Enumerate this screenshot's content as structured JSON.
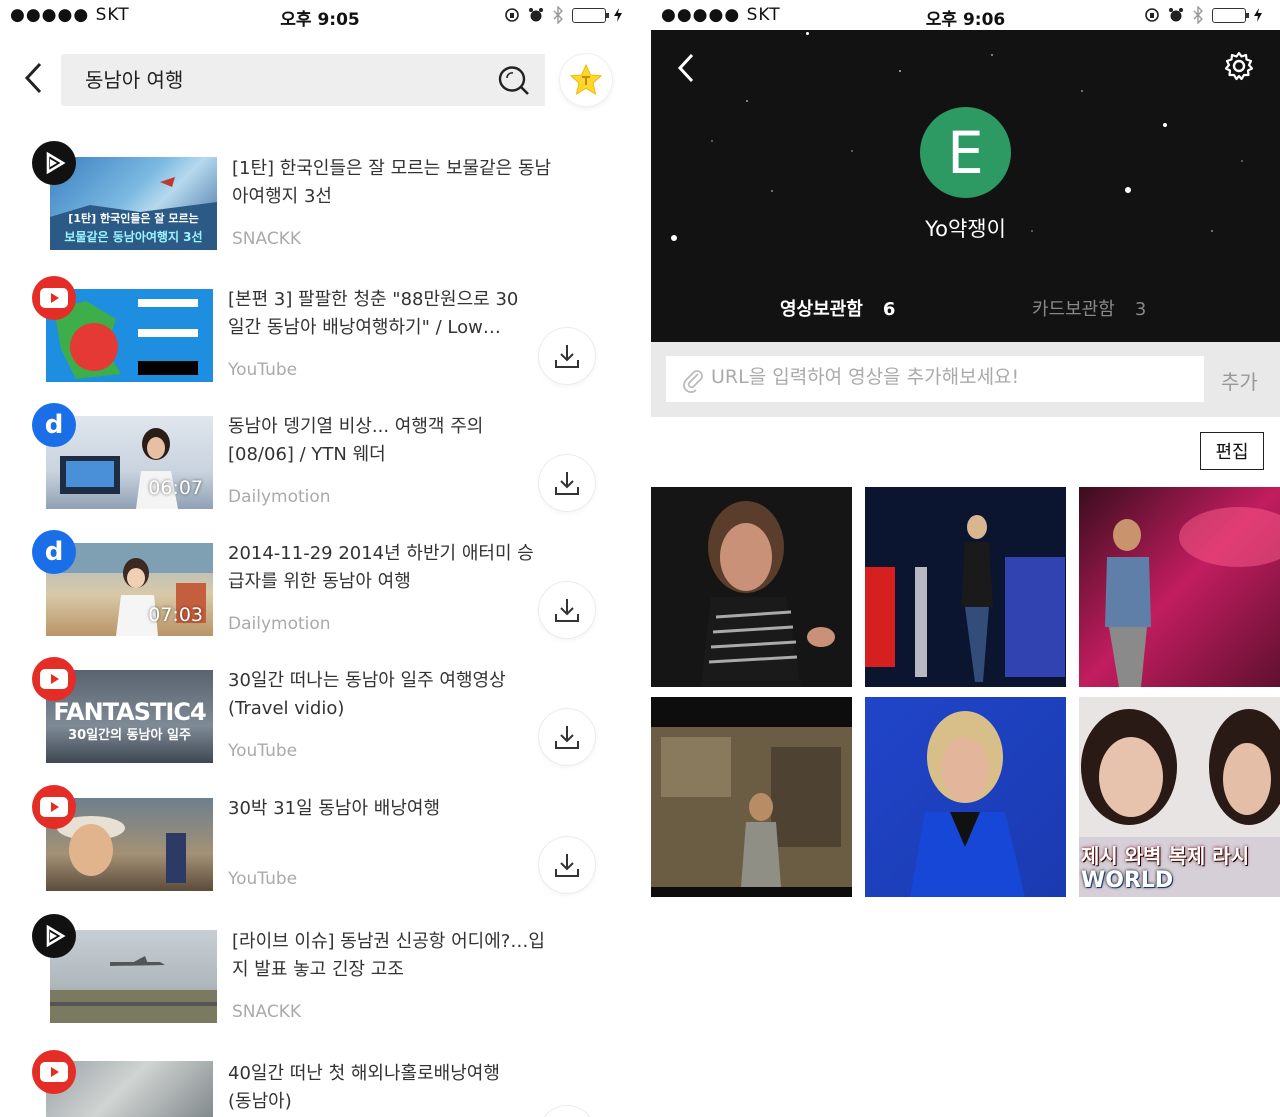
{
  "left": {
    "status": {
      "carrier": "●●●●● SKT",
      "time": "오후 9:05"
    },
    "search": {
      "query": "동남아 여행"
    },
    "results": [
      {
        "title_line1": "[1탄] 한국인들은 잘 모르는 보물같은 동남",
        "title_line2": "아여행지 3선",
        "source": "SNACKK",
        "badge": "snackk",
        "thumb_caption1": "[1탄] 한국인들은 잘 모르는",
        "thumb_caption2": "보물같은 동남아여행지 3선"
      },
      {
        "title_line1": "[본편 3] 팔팔한 청춘 \"88만원으로 30",
        "title_line2": "일간 동남아 배낭여행하기\" / Low…",
        "source": "YouTube",
        "badge": "youtube"
      },
      {
        "title_line1": "동남아 뎅기열 비상... 여행객 주의",
        "title_line2": "[08/06] / YTN 웨더",
        "source": "Dailymotion",
        "badge": "dailymotion",
        "duration": "06:07"
      },
      {
        "title_line1": "2014-11-29 2014년 하반기 애터미 승",
        "title_line2": "급자를 위한 동남아 여행",
        "source": "Dailymotion",
        "badge": "dailymotion",
        "duration": "07:03"
      },
      {
        "title_line1": "30일간 떠나는 동남아 일주 여행영상",
        "title_line2": "(Travel vidio)",
        "source": "YouTube",
        "badge": "youtube",
        "thumb_caption1": "FANTASTIC4",
        "thumb_caption2": "30일간의 동남아 일주"
      },
      {
        "title_line1": "30박 31일 동남아 배낭여행",
        "title_line2": "",
        "source": "YouTube",
        "badge": "youtube"
      },
      {
        "title_line1": "[라이브 이슈] 동남권 신공항 어디에?…입",
        "title_line2": "지 발표 놓고 긴장 고조",
        "source": "SNACKK",
        "badge": "snackk"
      },
      {
        "title_line1": "40일간 떠난 첫 해외나홀로배낭여행",
        "title_line2": "(동남아)",
        "source": "",
        "badge": "youtube"
      }
    ]
  },
  "right": {
    "status": {
      "carrier": "●●●●● SKT",
      "time": "오후 9:06"
    },
    "profile": {
      "initial": "E",
      "name": "Yo약쟁이",
      "avatar_color": "#2e9a63"
    },
    "tabs": {
      "video_label": "영상보관함",
      "video_count": "6",
      "card_label": "카드보관함",
      "card_count": "3"
    },
    "url": {
      "placeholder": "URL을 입력하여 영상을 추가해보세요!",
      "add_label": "추가"
    },
    "edit_label": "편집",
    "grid_caption": {
      "line1": "제시 와벽 복제 라시",
      "line2": "WORLD"
    }
  }
}
